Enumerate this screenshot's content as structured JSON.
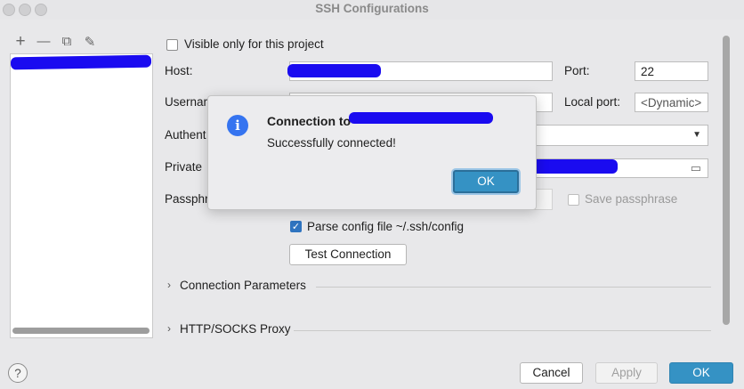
{
  "window": {
    "title": "SSH Configurations"
  },
  "left_panel": {
    "toolbar": {
      "add": "+",
      "remove": "—",
      "copy": "⧉",
      "edit": "✎"
    }
  },
  "form": {
    "visible_only_label": "Visible only for this project",
    "host_label": "Host:",
    "port_label": "Port:",
    "port_value": "22",
    "username_label": "Usernar",
    "local_port_label": "Local port:",
    "local_port_placeholder": "<Dynamic>",
    "auth_label": "Authent",
    "private_label": "Private",
    "passphrase_label": "Passphr",
    "save_passphrase_label": "Save passphrase",
    "parse_config_label": "Parse config file ~/.ssh/config",
    "parse_config_checked": true,
    "test_connection_label": "Test Connection",
    "connection_params_label": "Connection Parameters",
    "proxy_label": "HTTP/SOCKS Proxy"
  },
  "dialog": {
    "title_prefix": "Connection to",
    "message": "Successfully connected!",
    "ok_label": "OK"
  },
  "footer": {
    "help": "?",
    "cancel_label": "Cancel",
    "apply_label": "Apply",
    "ok_label": "OK"
  },
  "colors": {
    "accent": "#3592c4",
    "redaction": "#1a0bf0",
    "info_icon": "#3574f0"
  }
}
